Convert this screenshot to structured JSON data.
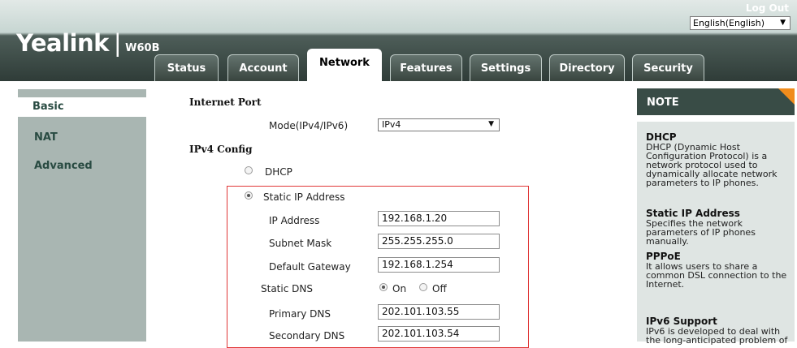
{
  "header": {
    "brand": "Yealink",
    "model": "W60B",
    "logout": "Log Out",
    "language": "English(English)"
  },
  "tabs": [
    {
      "label": "Status"
    },
    {
      "label": "Account"
    },
    {
      "label": "Network",
      "active": true
    },
    {
      "label": "Features"
    },
    {
      "label": "Settings"
    },
    {
      "label": "Directory"
    },
    {
      "label": "Security"
    }
  ],
  "sidebar": {
    "items": [
      {
        "label": "Basic",
        "active": true
      },
      {
        "label": "NAT"
      },
      {
        "label": "Advanced"
      }
    ]
  },
  "form": {
    "internet_port": "Internet Port",
    "mode_label": "Mode(IPv4/IPv6)",
    "mode_value": "IPv4",
    "ipv4_config": "IPv4 Config",
    "dhcp_label": "DHCP",
    "static_label": "Static IP Address",
    "ip_label": "IP Address",
    "ip_value": "192.168.1.20",
    "mask_label": "Subnet Mask",
    "mask_value": "255.255.255.0",
    "gw_label": "Default Gateway",
    "gw_value": "192.168.1.254",
    "static_dns_label": "Static DNS",
    "on_label": "On",
    "off_label": "Off",
    "pdns_label": "Primary DNS",
    "pdns_value": "202.101.103.55",
    "sdns_label": "Secondary DNS",
    "sdns_value": "202.101.103.54"
  },
  "note": {
    "heading": "NOTE",
    "dhcp_title": "DHCP",
    "dhcp_text": "DHCP (Dynamic Host Configuration Protocol) is a network protocol used to dynamically allocate network parameters to IP phones.",
    "static_title": "Static IP Address",
    "static_text": "Specifies the network parameters of IP phones manually.",
    "pppoe_title": "PPPoE",
    "pppoe_text": "It allows users to share a common DSL connection to the Internet.",
    "ipv6_title": "IPv6 Support",
    "ipv6_text": "IPv6 is developed to deal with the long-anticipated problem of"
  },
  "colors": {
    "header_dark": "#2f3c38",
    "sidebar": "#a9b6b2",
    "link_green": "#294b42",
    "note_head": "#394c46",
    "note_body": "#dfe5e3",
    "accent_orange": "#f08c1c",
    "highlight_red": "#e03737"
  }
}
